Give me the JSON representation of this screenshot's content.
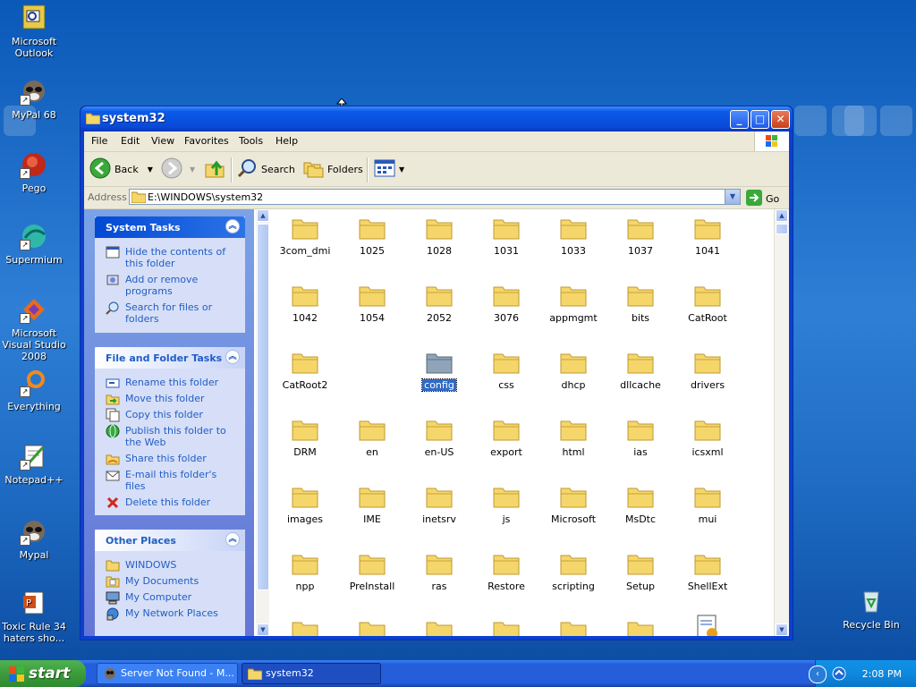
{
  "desktop": {
    "icons": [
      {
        "label": "Microsoft Outlook",
        "icon": "outlook-icon"
      },
      {
        "label": "MyPal 68",
        "icon": "raccoon-icon"
      },
      {
        "label": "Pego",
        "icon": "pego-icon"
      },
      {
        "label": "Supermium",
        "icon": "supermium-icon"
      },
      {
        "label": "Microsoft Visual Studio 2008",
        "icon": "visual-studio-icon"
      },
      {
        "label": "Everything",
        "icon": "everything-icon"
      },
      {
        "label": "Notepad++",
        "icon": "notepadpp-icon"
      },
      {
        "label": "Mypal",
        "icon": "raccoon-icon"
      },
      {
        "label": "Toxic Rule 34 haters sho...",
        "icon": "powerpoint-icon"
      }
    ],
    "recycle_bin": {
      "label": "Recycle Bin"
    }
  },
  "window": {
    "title": "system32",
    "menu": [
      "File",
      "Edit",
      "View",
      "Favorites",
      "Tools",
      "Help"
    ],
    "toolbar": {
      "back": "Back",
      "search": "Search",
      "folders": "Folders"
    },
    "address": {
      "label": "Address",
      "value": "E:\\WINDOWS\\system32",
      "go": "Go"
    },
    "panels": {
      "system_tasks": {
        "title": "System Tasks",
        "items": [
          "Hide the contents of this folder",
          "Add or remove programs",
          "Search for files or folders"
        ]
      },
      "file_folder_tasks": {
        "title": "File and Folder Tasks",
        "items": [
          "Rename this folder",
          "Move this folder",
          "Copy this folder",
          "Publish this folder to the Web",
          "Share this folder",
          "E-mail this folder's files",
          "Delete this folder"
        ]
      },
      "other_places": {
        "title": "Other Places",
        "items": [
          "WINDOWS",
          "My Documents",
          "My Computer",
          "My Network Places"
        ]
      }
    },
    "files": [
      "3com_dmi",
      "1025",
      "1028",
      "1031",
      "1033",
      "1037",
      "1041",
      "1042",
      "1054",
      "2052",
      "3076",
      "appmgmt",
      "bits",
      "CatRoot",
      "CatRoot2",
      "",
      "config",
      "css",
      "dhcp",
      "dllcache",
      "drivers",
      "DRM",
      "en",
      "en-US",
      "export",
      "html",
      "ias",
      "icsxml",
      "images",
      "IME",
      "inetsrv",
      "js",
      "Microsoft",
      "MsDtc",
      "mui",
      "npp",
      "PreInstall",
      "ras",
      "Restore",
      "scripting",
      "Setup",
      "ShellExt"
    ],
    "selected_file": "config"
  },
  "taskbar": {
    "start": "start",
    "tasks": [
      {
        "label": "Server Not Found - M...",
        "icon": "browser-icon"
      },
      {
        "label": "system32",
        "icon": "folder-icon"
      }
    ],
    "clock": "2:08 PM"
  }
}
